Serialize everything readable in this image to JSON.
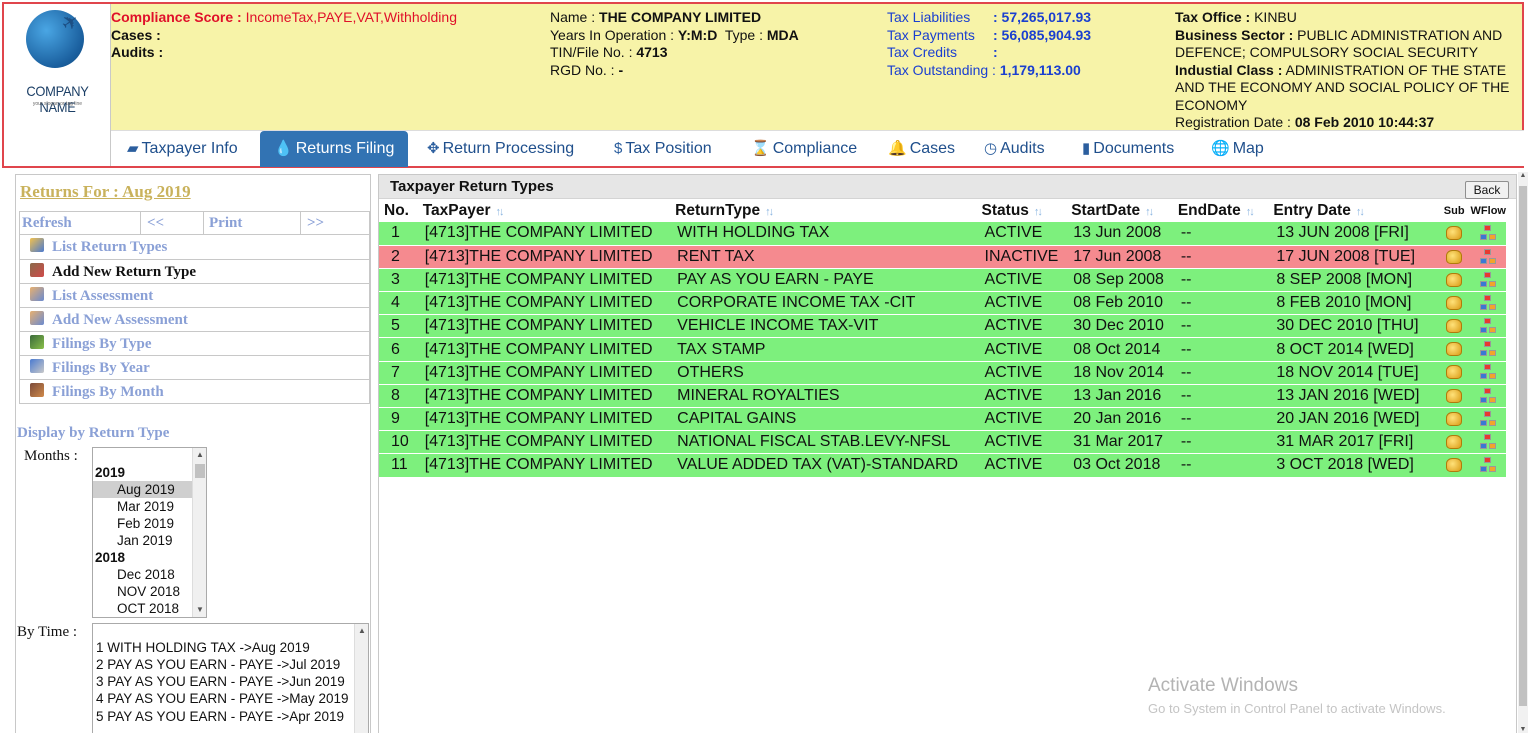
{
  "logo": {
    "name": "COMPANY NAME",
    "slogan": "your slogan or tag line"
  },
  "header": {
    "compliance_label": "Compliance Score :",
    "compliance_value": "IncomeTax,PAYE,VAT,Withholding",
    "cases_label": "Cases :",
    "audits_label": "Audits :",
    "name_label": "Name :",
    "name_value": "THE COMPANY LIMITED",
    "years_label": "Years In Operation :",
    "years_value": "Y:M:D",
    "type_label": "Type :",
    "type_value": "MDA",
    "tin_label": "TIN/File No. :",
    "tin_value": "4713",
    "rgd_label": "RGD No. :",
    "rgd_value": "-",
    "tax_liabilities_label": "Tax Liabilities",
    "tax_liabilities_value": ": 57,265,017.93",
    "tax_payments_label": "Tax Payments",
    "tax_payments_value": ": 56,085,904.93",
    "tax_credits_label": "Tax Credits",
    "tax_credits_value": ":",
    "tax_outstanding_label": "Tax Outstanding :",
    "tax_outstanding_value": "1,179,113.00",
    "tax_office_label": "Tax Office :",
    "tax_office_value": "KINBU",
    "business_sector_label": "Business Sector :",
    "business_sector_value": "PUBLIC ADMINISTRATION AND DEFENCE; COMPULSORY SOCIAL SECURITY",
    "industrial_class_label": "Industial Class :",
    "industrial_class_value": "ADMINISTRATION OF THE STATE AND THE ECONOMY AND SOCIAL POLICY OF THE ECONOMY",
    "registration_label": "Registration Date :",
    "registration_value": "08 Feb 2010 10:44:37"
  },
  "nav": {
    "tabs": [
      {
        "label": "Taxpayer Info",
        "icon": "folder-open-icon"
      },
      {
        "label": "Returns Filing",
        "icon": "drop-icon",
        "active": true
      },
      {
        "label": "Return Processing",
        "icon": "move-arrows-icon"
      },
      {
        "label": "Tax Position",
        "icon": "dollar-icon"
      },
      {
        "label": "Compliance",
        "icon": "hourglass-icon"
      },
      {
        "label": "Cases",
        "icon": "bell-icon"
      },
      {
        "label": "Audits",
        "icon": "clock-icon"
      },
      {
        "label": "Documents",
        "icon": "document-icon"
      },
      {
        "label": "Map",
        "icon": "globe-icon"
      }
    ]
  },
  "sidebar": {
    "returns_for": "Returns For :  Aug 2019",
    "toolbar": {
      "refresh": "Refresh",
      "prev": "<<",
      "print": "Print",
      "next": ">>"
    },
    "menu": [
      {
        "label": "List Return Types"
      },
      {
        "label": "Add New Return Type"
      },
      {
        "label": "List Assessment"
      },
      {
        "label": "Add New Assessment"
      },
      {
        "label": "Filings By Type"
      },
      {
        "label": "Filings By Year"
      },
      {
        "label": "Filings By Month"
      }
    ],
    "display_label": "Display by Return Type",
    "months_label": "Months :",
    "months": [
      {
        "group": "2019"
      },
      {
        "option": "Aug 2019",
        "selected": true
      },
      {
        "option": "Mar 2019"
      },
      {
        "option": "Feb 2019"
      },
      {
        "option": "Jan 2019"
      },
      {
        "group": "2018"
      },
      {
        "option": "Dec 2018"
      },
      {
        "option": "NOV 2018"
      },
      {
        "option": "OCT 2018"
      }
    ],
    "bytime_label": "By Time :",
    "bytime": [
      "1  WITH HOLDING TAX ->Aug 2019",
      "2  PAY AS YOU EARN - PAYE ->Jul 2019",
      "3  PAY AS YOU EARN - PAYE ->Jun 2019",
      "4  PAY AS YOU EARN - PAYE ->May 2019",
      "5  PAY AS YOU EARN - PAYE ->Apr 2019"
    ]
  },
  "main": {
    "title": "Taxpayer Return Types",
    "back_label": "Back",
    "columns": [
      "No.",
      "TaxPayer",
      "ReturnType",
      "Status",
      "StartDate",
      "EndDate",
      "Entry Date",
      "Sub",
      "WFlow"
    ],
    "rows": [
      {
        "no": "1",
        "taxpayer": "[4713]THE COMPANY LIMITED",
        "type": "WITH HOLDING TAX",
        "status": "ACTIVE",
        "start": "13 Jun 2008",
        "end": "--",
        "entry": "13 JUN 2008 [FRI]"
      },
      {
        "no": "2",
        "taxpayer": "[4713]THE COMPANY LIMITED",
        "type": "RENT TAX",
        "status": "INACTIVE",
        "start": "17 Jun 2008",
        "end": "--",
        "entry": "17 JUN 2008 [TUE]"
      },
      {
        "no": "3",
        "taxpayer": "[4713]THE COMPANY LIMITED",
        "type": "PAY AS YOU EARN - PAYE",
        "status": "ACTIVE",
        "start": "08 Sep 2008",
        "end": "--",
        "entry": "8 SEP 2008 [MON]"
      },
      {
        "no": "4",
        "taxpayer": "[4713]THE COMPANY LIMITED",
        "type": "CORPORATE INCOME TAX -CIT",
        "status": "ACTIVE",
        "start": "08 Feb 2010",
        "end": "--",
        "entry": "8 FEB 2010 [MON]"
      },
      {
        "no": "5",
        "taxpayer": "[4713]THE COMPANY LIMITED",
        "type": "VEHICLE INCOME TAX-VIT",
        "status": "ACTIVE",
        "start": "30 Dec 2010",
        "end": "--",
        "entry": "30 DEC 2010 [THU]"
      },
      {
        "no": "6",
        "taxpayer": "[4713]THE COMPANY LIMITED",
        "type": "TAX STAMP",
        "status": "ACTIVE",
        "start": "08 Oct 2014",
        "end": "--",
        "entry": "8 OCT 2014 [WED]"
      },
      {
        "no": "7",
        "taxpayer": "[4713]THE COMPANY LIMITED",
        "type": "OTHERS",
        "status": "ACTIVE",
        "start": "18 Nov 2014",
        "end": "--",
        "entry": "18 NOV 2014 [TUE]"
      },
      {
        "no": "8",
        "taxpayer": "[4713]THE COMPANY LIMITED",
        "type": "MINERAL ROYALTIES",
        "status": "ACTIVE",
        "start": "13 Jan 2016",
        "end": "--",
        "entry": "13 JAN 2016 [WED]"
      },
      {
        "no": "9",
        "taxpayer": "[4713]THE COMPANY LIMITED",
        "type": "CAPITAL GAINS",
        "status": "ACTIVE",
        "start": "20 Jan 2016",
        "end": "--",
        "entry": "20 JAN 2016 [WED]"
      },
      {
        "no": "10",
        "taxpayer": "[4713]THE COMPANY LIMITED",
        "type": "NATIONAL FISCAL STAB.LEVY-NFSL",
        "status": "ACTIVE",
        "start": "31 Mar 2017",
        "end": "--",
        "entry": "31 MAR 2017 [FRI]"
      },
      {
        "no": "11",
        "taxpayer": "[4713]THE COMPANY LIMITED",
        "type": "VALUE ADDED TAX (VAT)-STANDARD",
        "status": "ACTIVE",
        "start": "03 Oct 2018",
        "end": "--",
        "entry": "3 OCT 2018 [WED]"
      }
    ]
  },
  "watermark": {
    "line1": "Activate Windows",
    "line2": "Go to System in Control Panel to activate Windows."
  },
  "colors": {
    "active_row": "#7df07d",
    "inactive_row": "#f58a8f",
    "header_bg": "#f7f3a8",
    "active_tab": "#3273b3",
    "border_red": "#e0454c"
  }
}
